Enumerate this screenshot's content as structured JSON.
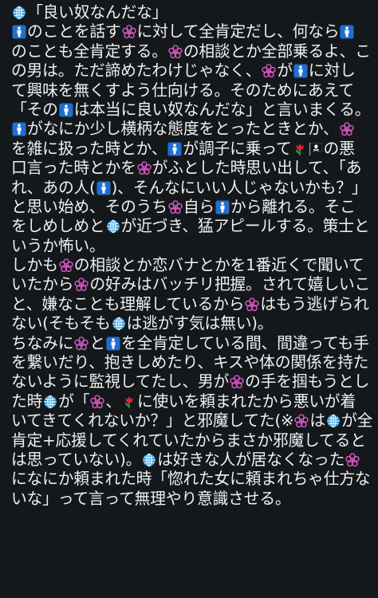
{
  "icons": {
    "globe": "globe-with-meridians-icon",
    "man": "mens-room-sign-icon",
    "flower": "white-flower-icon",
    "tulip": "tulip-icon",
    "pirate": "pirate-flag-icon"
  },
  "colors": {
    "background": "#15181b",
    "text": "#eef0f2",
    "globe": "#2d9be0",
    "man_tile": "#1e6fd0",
    "flower": "#e45bcf",
    "tulip_petal": "#e2223a",
    "tulip_leaf": "#3aa23e"
  },
  "lines": [
    [
      {
        "icon": "globe"
      },
      {
        "t": "「良い奴なんだな」"
      }
    ],
    [
      {
        "icon": "man"
      },
      {
        "t": "のことを話す"
      },
      {
        "icon": "flower"
      },
      {
        "t": "に対して全肯定だし、何なら"
      },
      {
        "icon": "man"
      }
    ],
    [
      {
        "t": "のことも全肯定する。"
      },
      {
        "icon": "flower"
      },
      {
        "t": "の相談とか全部乗るよ、こ"
      }
    ],
    [
      {
        "t": "の男は。ただ諦めたわけじゃなく、"
      },
      {
        "icon": "flower"
      },
      {
        "t": "が"
      },
      {
        "icon": "man"
      },
      {
        "t": "に対し"
      }
    ],
    [
      {
        "t": "て興味を無くすよう仕向ける。そのためにあえて"
      }
    ],
    [
      {
        "t": "「その"
      },
      {
        "icon": "man"
      },
      {
        "t": "は本当に良い奴なんだな」と言いまくる。"
      }
    ],
    [
      {
        "icon": "man"
      },
      {
        "t": "がなにか少し横柄な態度をとったときとか、"
      },
      {
        "icon": "flower"
      }
    ],
    [
      {
        "t": "を雑に扱った時とか、"
      },
      {
        "icon": "man"
      },
      {
        "t": "が調子に乗って"
      },
      {
        "icon": "tulip"
      },
      {
        "icon": "pirate"
      },
      {
        "t": "の悪"
      }
    ],
    [
      {
        "t": "口言った時とかを"
      },
      {
        "icon": "flower"
      },
      {
        "t": "がふとした時思い出して、「あ"
      }
    ],
    [
      {
        "t": "れ、あの人("
      },
      {
        "icon": "man"
      },
      {
        "t": ")、そんなにいい人じゃないかも？」"
      }
    ],
    [
      {
        "t": "と思い始め、そのうち"
      },
      {
        "icon": "flower"
      },
      {
        "t": "自ら"
      },
      {
        "icon": "man"
      },
      {
        "t": "から離れる。そこ"
      }
    ],
    [
      {
        "t": "をしめしめと"
      },
      {
        "icon": "globe"
      },
      {
        "t": "が近づき、猛アピールする。策士と"
      }
    ],
    [
      {
        "t": "いうか怖い。"
      }
    ],
    [
      {
        "t": "しかも"
      },
      {
        "icon": "flower"
      },
      {
        "t": "の相談とか恋バナとかを1番近くで聞いて"
      }
    ],
    [
      {
        "t": "いたから"
      },
      {
        "icon": "flower"
      },
      {
        "t": "の好みはバッチリ把握。されて嬉しいこ"
      }
    ],
    [
      {
        "t": "と、嫌なことも理解しているから"
      },
      {
        "icon": "flower"
      },
      {
        "t": "はもう逃げられ"
      }
    ],
    [
      {
        "t": "ない(そもそも"
      },
      {
        "icon": "globe"
      },
      {
        "t": "は逃がす気は無い)。"
      }
    ],
    [
      {
        "t": "ちなみに"
      },
      {
        "icon": "flower"
      },
      {
        "t": "と"
      },
      {
        "icon": "man"
      },
      {
        "t": "を全肯定している間、間違っても手"
      }
    ],
    [
      {
        "t": "を繋いだり、抱きしめたり、キスや体の関係を持た"
      }
    ],
    [
      {
        "t": "ないように監視してたし、男が"
      },
      {
        "icon": "flower"
      },
      {
        "t": "の手を掴もうとし"
      }
    ],
    [
      {
        "t": "た時"
      },
      {
        "icon": "globe"
      },
      {
        "t": "が「"
      },
      {
        "icon": "flower"
      },
      {
        "t": "、"
      },
      {
        "icon": "tulip"
      },
      {
        "t": "に使いを頼まれたから悪いが着"
      }
    ],
    [
      {
        "t": "いてきてくれないか？」と邪魔してた(※"
      },
      {
        "icon": "flower"
      },
      {
        "t": "は"
      },
      {
        "icon": "globe"
      },
      {
        "t": "が全"
      }
    ],
    [
      {
        "t": "肯定+応援してくれていたからまさか邪魔してると"
      }
    ],
    [
      {
        "t": "は思っていない)。"
      },
      {
        "icon": "globe"
      },
      {
        "t": "は好きな人が居なくなった"
      },
      {
        "icon": "flower"
      }
    ],
    [
      {
        "t": "になにか頼まれた時「惚れた女に頼まれちゃ仕方な"
      }
    ],
    [
      {
        "t": "いな」って言って無理やり意識させる。"
      }
    ]
  ]
}
